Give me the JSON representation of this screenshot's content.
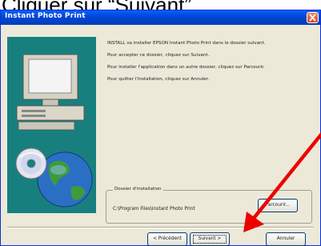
{
  "caption": "Cliquer sur “Suivant”",
  "window": {
    "title": "Instant Photo Print"
  },
  "content": {
    "paragraphs": [
      "INSTALL va installer EPSON Instant Photo Print dans le dossier suivant.",
      "Pour accepter ce dossier, cliquez sur Suivant.",
      "Pour installer l'application dans un autre dossier, cliquez sur Parcourir.",
      "Pour quitter l'installation, cliquez sur Annuler."
    ],
    "group_label": "Dossier d'installation",
    "install_path": "C:\\Program Files\\Instant Photo Print",
    "browse_label": "Parcourir..."
  },
  "buttons": {
    "back": "< Précédent",
    "next": "Suivant >",
    "cancel": "Annuler"
  },
  "icons": {
    "close": "close-icon",
    "illustration": "computer-globe-illustration",
    "arrow": "red-arrow-annotation"
  },
  "colors": {
    "titlebar": "#0046d5",
    "window": "#ece9d8",
    "illustration_bg": "#17807f",
    "arrow": "#ee0000"
  }
}
